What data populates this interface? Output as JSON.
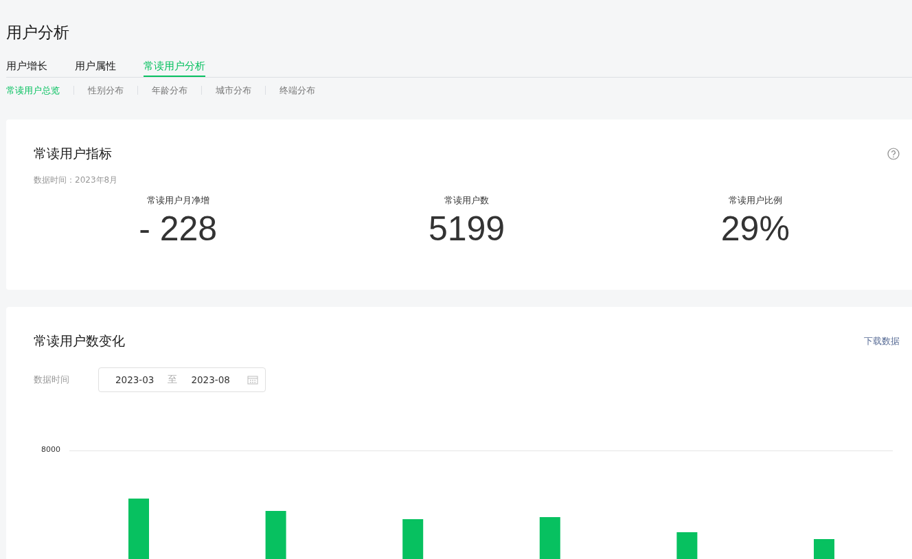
{
  "page_title": "用户分析",
  "tabs": [
    {
      "label": "用户增长",
      "selected": false
    },
    {
      "label": "用户属性",
      "selected": false
    },
    {
      "label": "常读用户分析",
      "selected": true
    }
  ],
  "subtabs": [
    {
      "label": "常读用户总览",
      "selected": true
    },
    {
      "label": "性别分布",
      "selected": false
    },
    {
      "label": "年龄分布",
      "selected": false
    },
    {
      "label": "城市分布",
      "selected": false
    },
    {
      "label": "终端分布",
      "selected": false
    }
  ],
  "indicators": {
    "title": "常读用户指标",
    "data_time": "数据时间：2023年8月",
    "metrics": [
      {
        "label": "常读用户月净增",
        "value": "- 228"
      },
      {
        "label": "常读用户数",
        "value": "5199"
      },
      {
        "label": "常读用户比例",
        "value": "29%"
      }
    ]
  },
  "trend": {
    "title": "常读用户数变化",
    "download_link": "下载数据",
    "date_label": "数据时间",
    "date_range": {
      "start": "2023-03",
      "separator": "至",
      "end": "2023-08"
    },
    "chart": {
      "y_tick": "8000"
    }
  }
}
